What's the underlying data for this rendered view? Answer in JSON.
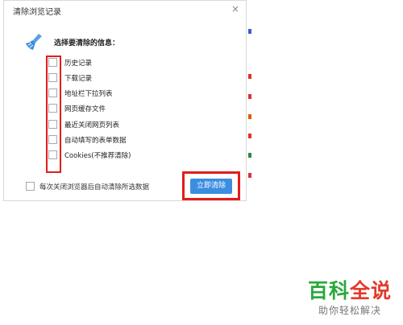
{
  "dialog": {
    "title": "清除浏览记录",
    "close_glyph": "×",
    "heading": "选择要清除的信息：",
    "options": [
      {
        "label": "历史记录",
        "checked": false
      },
      {
        "label": "下载记录",
        "checked": false
      },
      {
        "label": "地址栏下拉列表",
        "checked": false
      },
      {
        "label": "网页缓存文件",
        "checked": false
      },
      {
        "label": "最近关闭网页列表",
        "checked": false
      },
      {
        "label": "自动填写的表单数据",
        "checked": false
      },
      {
        "label": "Cookies(不推荐清除)",
        "checked": false
      }
    ],
    "auto_clear_label": "每次关闭浏览器后自动清除所选数据",
    "clear_button_label": "立即清除"
  },
  "watermark": {
    "title": "百科全说",
    "subtitle": "助你轻松解决"
  },
  "colors": {
    "accent_blue": "#3b8de0",
    "highlight_red": "#e21c1c",
    "watermark_green": "#2aa83c",
    "watermark_red": "#e23a2a"
  },
  "icons": {
    "broom": "broom-icon",
    "close": "close-icon"
  }
}
